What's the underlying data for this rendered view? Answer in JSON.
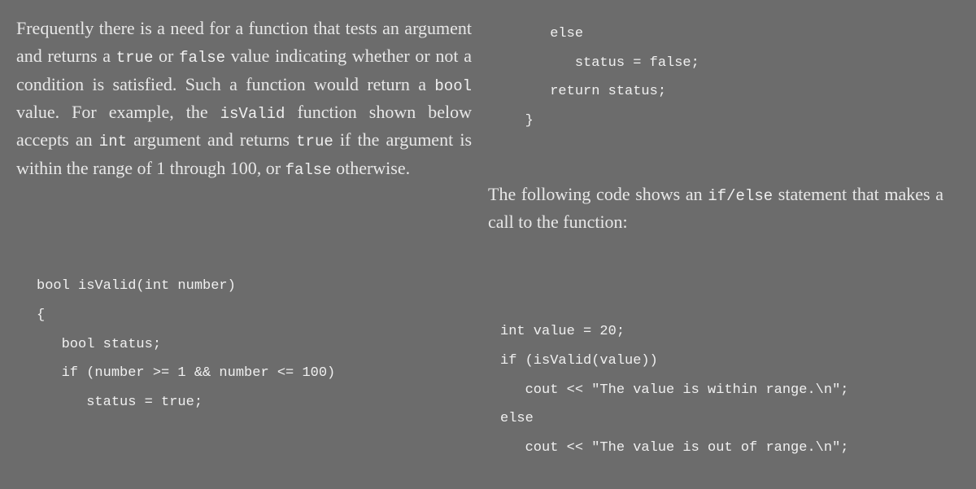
{
  "left": {
    "para1_parts": [
      "Frequently there is a need for a function that tests an argument and returns a ",
      "true",
      " or ",
      "false",
      " value indicating whether or not a condition is satisfied. Such a function would return a ",
      "bool",
      " value. For example, the ",
      "isValid",
      " function shown below accepts an ",
      "int",
      " argument and returns ",
      "true",
      " if the argument is within the range of 1 through 100, or ",
      "false",
      " otherwise."
    ],
    "code": "bool isValid(int number)\n{\n   bool status;\n   if (number >= 1 && number <= 100)\n      status = true;"
  },
  "right": {
    "code_top": "      else\n         status = false;\n      return status;\n   }",
    "para2_parts": [
      "The following code shows an ",
      "if/else",
      " statement that makes a call to the function:"
    ],
    "code_bottom": "int value = 20;\nif (isValid(value))\n   cout << \"The value is within range.\\n\";\nelse\n   cout << \"The value is out of range.\\n\";"
  }
}
